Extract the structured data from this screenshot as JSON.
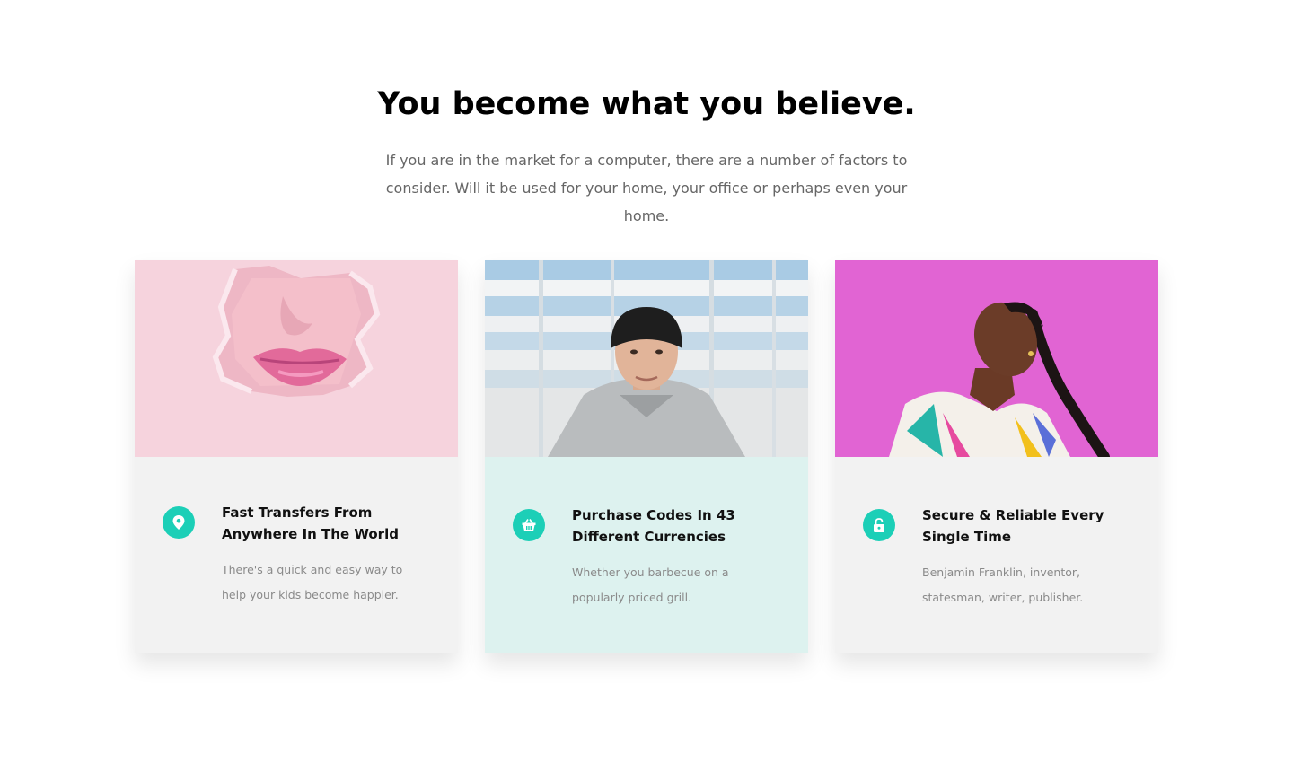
{
  "heading": "You become what you believe.",
  "intro": "If you are in the market for a computer, there are a number of factors to consider. Will it be used for your home, your office or perhaps even your home.",
  "colors": {
    "accent": "#1ccfb7",
    "card_bg": "#f2f2f2",
    "card_highlight_bg": "#ddf2ef"
  },
  "cards": [
    {
      "icon": "map-pin-icon",
      "image": "pink-lips-photo",
      "title": "Fast Transfers From Anywhere In The World",
      "text": "There's a quick and easy way to help your kids become happier."
    },
    {
      "icon": "basket-icon",
      "image": "young-man-beanie-photo",
      "title": "Purchase Codes In 43 Different Currencies",
      "text": "Whether you barbecue on a popularly priced grill."
    },
    {
      "icon": "unlock-icon",
      "image": "woman-pink-wall-photo",
      "title": "Secure & Reliable Every Single Time",
      "text": "Benjamin Franklin, inventor, statesman, writer, publisher."
    }
  ]
}
